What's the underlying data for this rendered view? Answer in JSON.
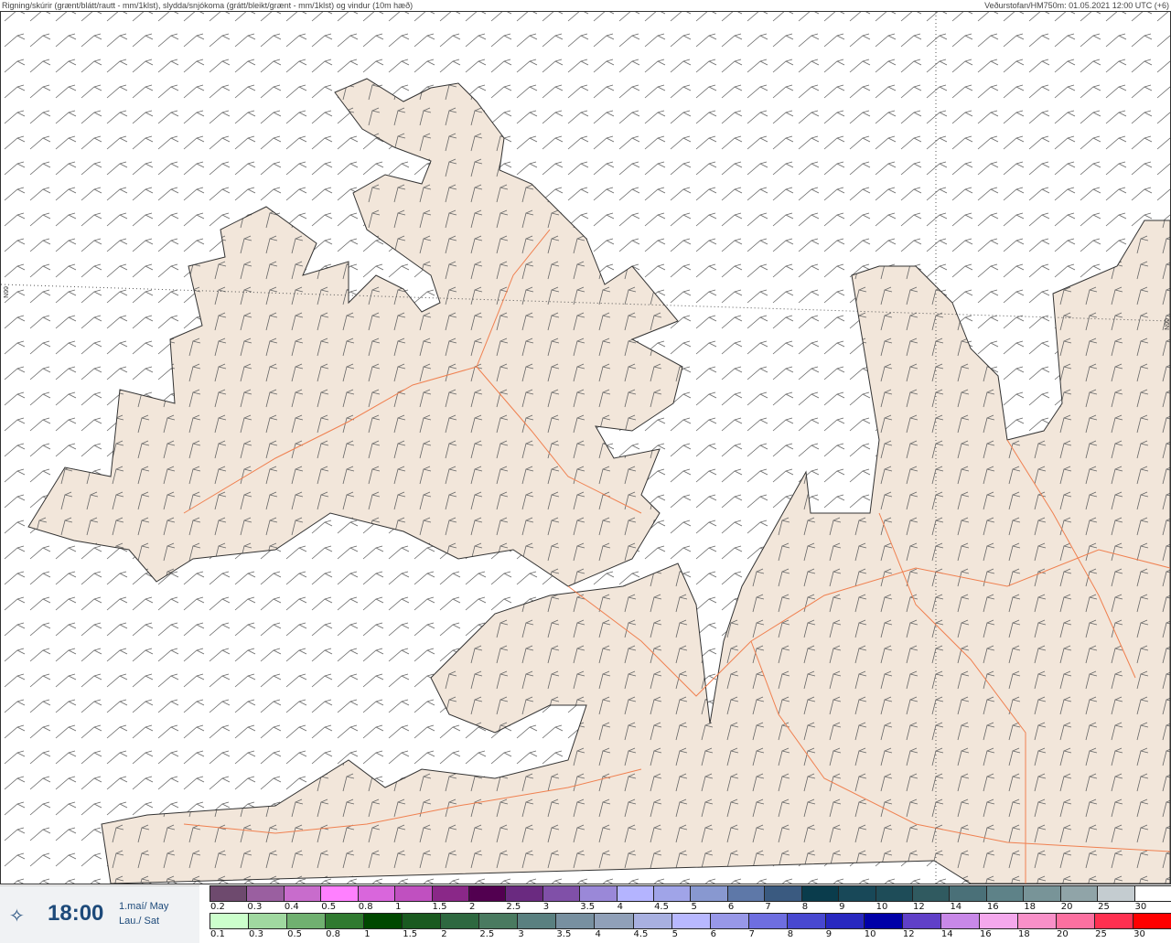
{
  "header": {
    "title": "Rigning/skúrir (grænt/blátt/rautt - mm/1klst), slydda/snjókoma (grátt/bleikt/grænt - mm/1klst) og vindur (10m hæð)",
    "source": "Veðurstofan/HM750m: 01.05.2021 12:00 UTC (+6)"
  },
  "map": {
    "lat_label_left": "66N",
    "lat_label_right": "66N",
    "colors": {
      "land": "#f2e6da",
      "sea": "#ffffff",
      "roads": "#f08050",
      "coast": "#333333",
      "barbs": "#555555"
    }
  },
  "timebox": {
    "icon": "wind-compass-icon",
    "time": "18:00",
    "date_line1": "1.maí/ May",
    "date_line2": "Lau./ Sat"
  },
  "legend": {
    "snow": {
      "labels": [
        "0.2",
        "0.3",
        "0.4",
        "0.5",
        "0.8",
        "1",
        "1.5",
        "2",
        "2.5",
        "3",
        "3.5",
        "4",
        "4.5",
        "5",
        "6",
        "7",
        "8",
        "9",
        "10",
        "12",
        "14",
        "16",
        "18",
        "20",
        "25",
        "30"
      ],
      "colors": [
        "#6e4a6e",
        "#9a5fa0",
        "#c86ccc",
        "#ff80ff",
        "#d966dc",
        "#c050c0",
        "#8a2888",
        "#520050",
        "#6a2a80",
        "#8050a8",
        "#9a88d8",
        "#b4b4ff",
        "#a0a4e8",
        "#8898d0",
        "#5e78a8",
        "#3a5a80",
        "#0a3c4c",
        "#184858",
        "#1e4c58",
        "#305a60",
        "#4a7078",
        "#5e8288",
        "#789498",
        "#90a4a8",
        "#c4ccd0",
        "#ffffff"
      ]
    },
    "rain": {
      "labels": [
        "0.1",
        "0.3",
        "0.5",
        "0.8",
        "1",
        "1.5",
        "2",
        "2.5",
        "3",
        "3.5",
        "4",
        "4.5",
        "5",
        "6",
        "7",
        "8",
        "9",
        "10",
        "12",
        "14",
        "16",
        "18",
        "20",
        "25",
        "30"
      ],
      "colors": [
        "#ccffcc",
        "#a0d8a0",
        "#70b070",
        "#307a30",
        "#004800",
        "#1a5a20",
        "#2e6840",
        "#4a7a60",
        "#5a8080",
        "#7890a0",
        "#90a0b8",
        "#a8b0e0",
        "#b8b8ff",
        "#9898e8",
        "#6e6ee0",
        "#4848d0",
        "#2828c0",
        "#0000a8",
        "#6040c8",
        "#c888e8",
        "#f4a8ec",
        "#f890c8",
        "#fc70a0",
        "#ff3050",
        "#ff0000"
      ]
    }
  }
}
